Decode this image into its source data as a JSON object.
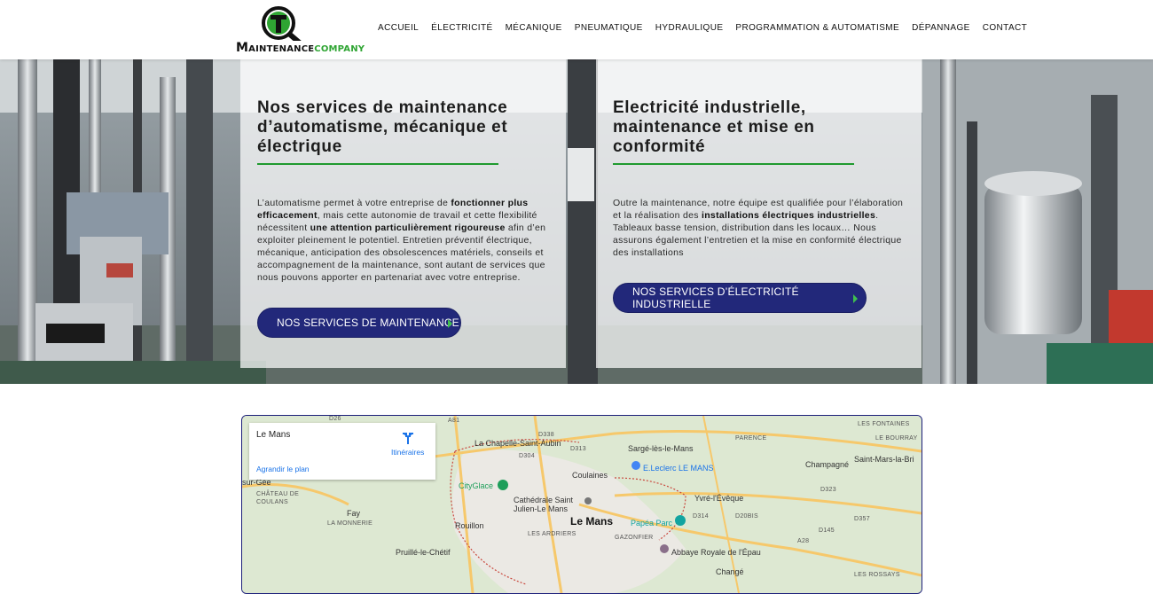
{
  "header": {
    "logo": {
      "wordmark_part1": "AINTENANCE",
      "wordmark_m": "M",
      "wordmark_c": "C",
      "wordmark_part2": "OMPANY",
      "alt": "Maintenance Company"
    },
    "nav": [
      {
        "label": "ACCUEIL"
      },
      {
        "label": "ÉLECTRICITÉ"
      },
      {
        "label": "MÉCANIQUE"
      },
      {
        "label": "PNEUMATIQUE"
      },
      {
        "label": "HYDRAULIQUE"
      },
      {
        "label": "PROGRAMMATION & AUTOMATISME"
      },
      {
        "label": "DÉPANNAGE"
      },
      {
        "label": "CONTACT"
      }
    ]
  },
  "cards": [
    {
      "title": "Nos services de maintenance d’automatisme, mécanique et électrique",
      "text_parts": [
        "L’automatisme permet à votre entreprise de ",
        "fonctionner plus efficacement",
        ", mais cette autonomie de travail et cette flexibilité nécessitent ",
        "une attention particulièrement rigoureuse",
        " afin d’en exploiter pleinement le potentiel. Entretien préventif électrique, mécanique, anticipation des obsolescences matériels, conseils et accompagnement de la maintenance, sont autant de services que nous pouvons apporter en partenariat avec votre entreprise."
      ],
      "button": "NOS SERVICES DE MAINTENANCE"
    },
    {
      "title": "Electricité industrielle, maintenance et mise en conformité",
      "text_parts": [
        "Outre la maintenance, notre équipe est qualifiée pour l’élaboration et la réalisation des ",
        "installations électriques industrielles",
        ". Tableaux basse tension, distribution dans les locaux…  Nous assurons également l’entretien et la mise en conformité électrique des installations"
      ],
      "button": "NOS SERVICES D’ÉLECTRICITÉ INDUSTRIELLE"
    }
  ],
  "map": {
    "place": "Le Mans",
    "directions": "Itinéraires",
    "enlarge": "Agrandir le plan",
    "labels": {
      "city": "Le Mans",
      "chapelle": "La Chapelle-Saint-Aubin",
      "sarge": "Sargé-lès-le-Mans",
      "leclerc": "E.Leclerc LE MANS",
      "coulaines": "Coulaines",
      "cityglace": "CityGlace",
      "cathedrale": "Cathédrale Saint Julien-Le Mans",
      "yvre": "Yvré-l'Évêque",
      "papea": "Papéa Parc",
      "rouillon": "Rouillon",
      "fay": "Fay",
      "pruille": "Pruillé-le-Chétif",
      "abbaye": "Abbaye Royale de l'Épau",
      "change": "Changé",
      "champagne": "Champagné",
      "saintmars": "Saint-Mars-la-Bri",
      "suregee": "sur-Gée",
      "chateau": "CHÂTEAU DE COULANS",
      "monnerie": "LA MONNERIE",
      "ardriers": "LES ARDRIERS",
      "gazonfier": "GAZONFIER",
      "parence": "PARENCE",
      "fontaines": "LES FONTAINES",
      "bourray": "LE BOURRAY",
      "rossays": "LES ROSSAYS",
      "d338": "D338",
      "d313": "D313",
      "d304": "D304",
      "d314": "D314",
      "d323": "D323",
      "d357": "D357",
      "d145": "D145",
      "a28": "A28",
      "a81": "A81",
      "d20bis": "D20BIS",
      "d26": "D26"
    }
  },
  "colors": {
    "accent_green": "#1f9a2f",
    "button_navy": "#22287a",
    "map_border": "#1c1f7a"
  }
}
